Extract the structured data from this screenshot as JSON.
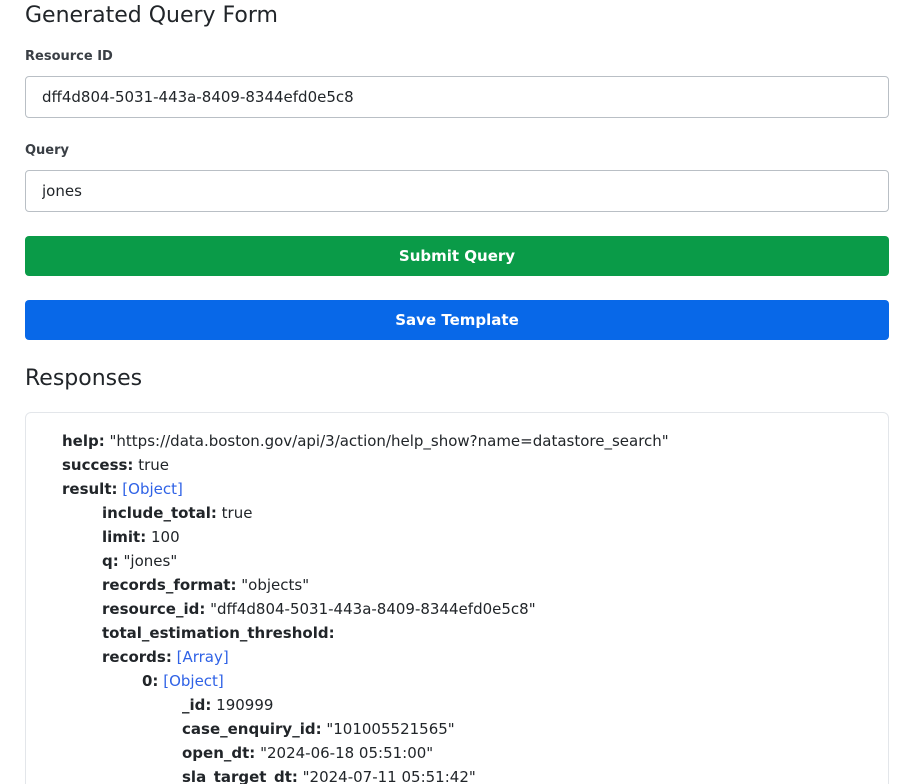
{
  "form": {
    "title": "Generated Query Form",
    "resource_id_label": "Resource ID",
    "resource_id_value": "dff4d804-5031-443a-8409-8344efd0e5c8",
    "query_label": "Query",
    "query_value": "jones",
    "submit_label": "Submit Query",
    "save_label": "Save Template"
  },
  "colors": {
    "submit_button": "#0a9b48",
    "save_button": "#0868e8",
    "link": "#2f62e6"
  },
  "responses": {
    "title": "Responses",
    "help_key": "help:",
    "help_value": "\"https://data.boston.gov/api/3/action/help_show?name=datastore_search\"",
    "success_key": "success:",
    "success_value": "true",
    "result_key": "result:",
    "result_value": "[Object]",
    "result": {
      "include_total_key": "include_total:",
      "include_total_value": "true",
      "limit_key": "limit:",
      "limit_value": "100",
      "q_key": "q:",
      "q_value": "\"jones\"",
      "records_format_key": "records_format:",
      "records_format_value": "\"objects\"",
      "resource_id_key": "resource_id:",
      "resource_id_value": "\"dff4d804-5031-443a-8409-8344efd0e5c8\"",
      "total_estimation_threshold_key": "total_estimation_threshold:",
      "records_key": "records:",
      "records_value": "[Array]",
      "record0_key": "0:",
      "record0_value": "[Object]",
      "record0": {
        "id_key": "_id:",
        "id_value": "190999",
        "case_enquiry_id_key": "case_enquiry_id:",
        "case_enquiry_id_value": "\"101005521565\"",
        "open_dt_key": "open_dt:",
        "open_dt_value": "\"2024-06-18 05:51:00\"",
        "sla_target_dt_key": "sla_target_dt:",
        "sla_target_dt_value": "\"2024-07-11 05:51:42\""
      }
    }
  }
}
